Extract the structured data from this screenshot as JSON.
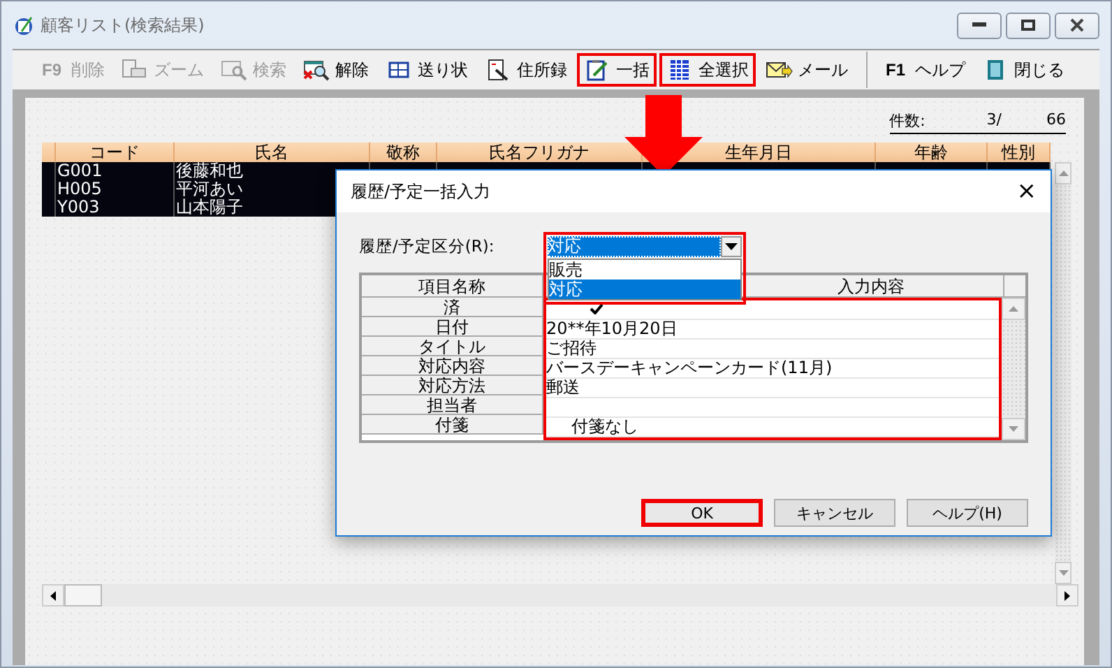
{
  "window": {
    "title": "顧客リスト(検索結果)"
  },
  "toolbar": [
    {
      "key": "F9",
      "label": "削除",
      "disabled": true,
      "highlighted": false
    },
    {
      "label": "ズーム",
      "disabled": true,
      "highlighted": false
    },
    {
      "label": "検索",
      "disabled": true,
      "highlighted": false
    },
    {
      "label": "解除",
      "disabled": false,
      "highlighted": false
    },
    {
      "label": "送り状",
      "disabled": false,
      "highlighted": false
    },
    {
      "label": "住所録",
      "disabled": false,
      "highlighted": false
    },
    {
      "label": "一括",
      "disabled": false,
      "highlighted": true
    },
    {
      "label": "全選択",
      "disabled": false,
      "highlighted": true
    },
    {
      "label": "メール",
      "disabled": false,
      "highlighted": false
    },
    {
      "key": "F1",
      "label": "ヘルプ",
      "disabled": false,
      "highlighted": false
    },
    {
      "label": "閉じる",
      "disabled": false,
      "highlighted": false
    }
  ],
  "count": {
    "label": "件数:",
    "shown": "3/",
    "total": "66"
  },
  "table": {
    "columns": [
      "コード",
      "氏名",
      "敬称",
      "氏名フリガナ",
      "生年月日",
      "年齢",
      "性別"
    ],
    "rows": [
      {
        "selected": true,
        "cells": [
          "G001",
          "後藤和也"
        ]
      },
      {
        "selected": true,
        "cells": [
          "H005",
          "平河あい"
        ]
      },
      {
        "selected": true,
        "cells": [
          "Y003",
          "山本陽子"
        ]
      }
    ]
  },
  "dialog": {
    "title": "履歴/予定一括入力",
    "close": "×",
    "type_label": "履歴/予定区分(R):",
    "type_value": "対応",
    "type_highlighted": true,
    "type_options": [
      {
        "label": "販売",
        "selected": false
      },
      {
        "label": "対応",
        "selected": true
      }
    ],
    "grid": {
      "columns": [
        "項目名称",
        "入力内容"
      ],
      "highlighted": true,
      "rows": [
        {
          "name": "済",
          "kind": "check",
          "checked": true
        },
        {
          "name": "日付",
          "kind": "text",
          "value": "20**年10月20日"
        },
        {
          "name": "タイトル",
          "kind": "text",
          "value": "ご招待"
        },
        {
          "name": "対応内容",
          "kind": "text",
          "value": "バースデーキャンペーンカード(11月)"
        },
        {
          "name": "対応方法",
          "kind": "text",
          "value": "郵送"
        },
        {
          "name": "担当者",
          "kind": "text"
        },
        {
          "name": "付箋",
          "kind": "indented",
          "value": "付箋なし"
        }
      ]
    },
    "buttons": [
      {
        "label": "OK",
        "highlighted": true
      },
      {
        "label": "キャンセル",
        "highlighted": false
      },
      {
        "label": "ヘルプ(H)",
        "highlighted": false
      }
    ]
  }
}
